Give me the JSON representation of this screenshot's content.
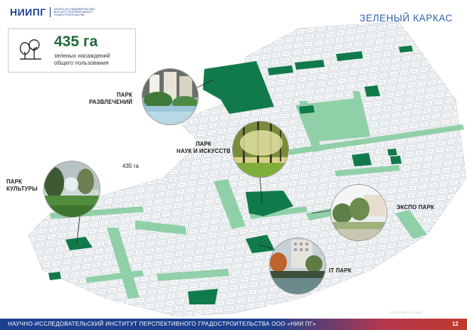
{
  "header": {
    "logo_text": "НИИПГ",
    "logo_subtitle": "НАУЧНО-ИССЛЕДОВАТЕЛЬСКИЙ ИНСТИТУТ ПЕРСПЕКТИВНОГО ГРАДОСТРОИТЕЛЬСТВА",
    "title": "ЗЕЛЕНЫЙ КАРКАС"
  },
  "summary": {
    "icon": "trees-icon",
    "value": "435 га",
    "description": "зеленых насаждений общего пользования"
  },
  "map": {
    "center_note": "435 га",
    "colors": {
      "park": "#117a4a",
      "green_strip": "#8ccfa5",
      "blocks": "#e4e9ec",
      "block_outline": "#b9c2c8"
    }
  },
  "parks": [
    {
      "line1": "ПАРК",
      "line2": "РАЗВЛЕЧЕНИЙ"
    },
    {
      "line1": "ПАРК",
      "line2": "НАУК И ИСКУССТВ"
    },
    {
      "line1": "ПАРК",
      "line2": "КУЛЬТУРЫ"
    },
    {
      "line1": "ЭКСПО ПАРК",
      "line2": ""
    },
    {
      "line1": "IT ПАРК",
      "line2": ""
    }
  ],
  "footer": {
    "text": "НАУЧНО-ИССЛЕДОВАТЕЛЬСКИЙ ИНСТИТУТ ПЕРСПЕКТИВНОГО ГРАДОСТРОИТЕЛЬСТВА    ООО «НИИ ПГ»",
    "page_number": "12",
    "watermark": "ООО «НИИ ПГ», 2021"
  },
  "colors": {
    "brand_blue": "#1f3f8f",
    "title_blue": "#2f5fa8",
    "footer_red": "#c0392b",
    "value_green": "#1e6a3a"
  }
}
